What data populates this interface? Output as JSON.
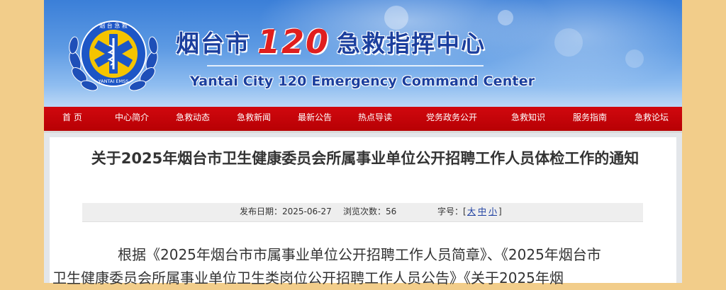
{
  "header": {
    "title_cn_prefix": "烟台市",
    "title_cn_num": "120",
    "title_cn_suffix": "急救指挥中心",
    "title_en": "Yantai City 120 Emergency Command Center",
    "emblem_top_text": "烟 台 急 救",
    "emblem_bottom_text": "YANTAI EMSS"
  },
  "nav": {
    "items": [
      "首 页",
      "中心简介",
      "急救动态",
      "急救新闻",
      "最新公告",
      "热点导读",
      "党务政务公开",
      "急救知识",
      "服务指南",
      "急救论坛"
    ]
  },
  "article": {
    "title": "关于2025年烟台市卫生健康委员会所属事业单位公开招聘工作人员体检工作的通知",
    "publish_label": "发布日期：",
    "publish_date": "2025-06-27",
    "views_label": "浏览次数：",
    "views": "56",
    "font_label": "字号：",
    "bracket_open": "[",
    "font_large": "大",
    "font_medium": "中",
    "font_small": "小",
    "bracket_close": "]",
    "body_line1": "根据《2025年烟台市市属事业单位公开招聘工作人员简章》、《2025年烟台市",
    "body_line2": "卫生健康委员会所属事业单位卫生类岗位公开招聘工作人员公告》《关于2025年烟"
  },
  "colors": {
    "nav_bg": "#c4060b",
    "banner_blue": "#3b7fd8",
    "title_blue": "#1b3f9e",
    "title_red": "#e01e1e",
    "page_bg": "#f2cd8a"
  }
}
